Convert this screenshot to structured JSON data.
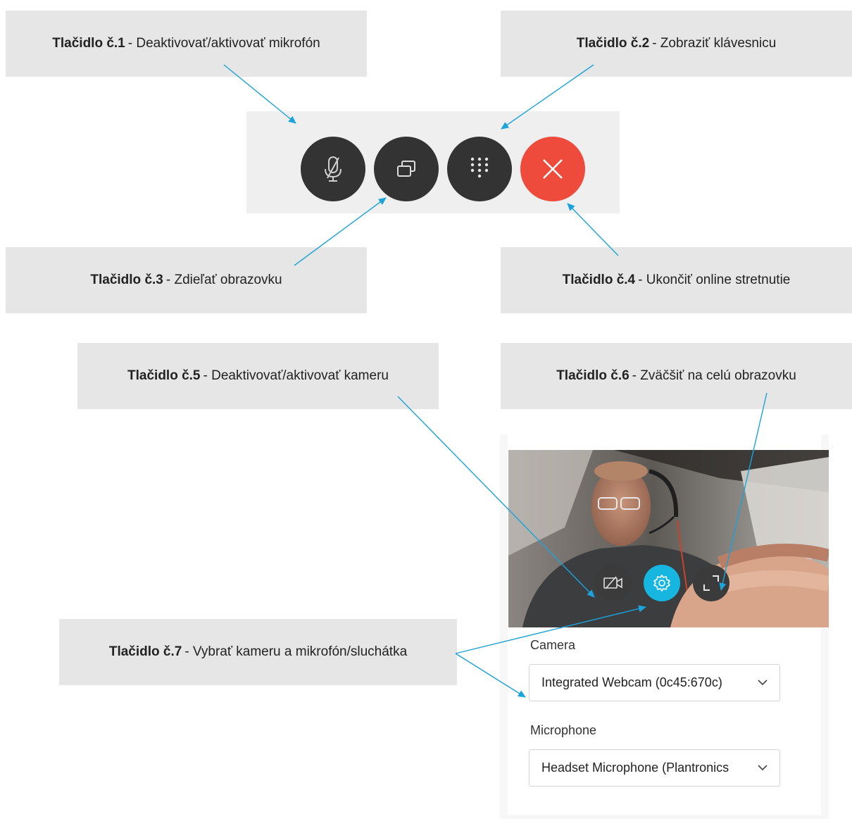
{
  "callouts": [
    {
      "bold": "Tlačidlo č.1",
      "text": " - Deaktivovať/aktivovať mikrofón"
    },
    {
      "bold": "Tlačidlo č.2",
      "text": " - Zobraziť klávesnicu"
    },
    {
      "bold": "Tlačidlo č.3",
      "text": " - Zdieľať obrazovku"
    },
    {
      "bold": "Tlačidlo č.4",
      "text": " - Ukončiť online stretnutie"
    },
    {
      "bold": "Tlačidlo č.5",
      "text": " - Deaktivovať/aktivovať kameru"
    },
    {
      "bold": "Tlačidlo č.6",
      "text": " - Zväčšiť na celú obrazovku"
    },
    {
      "bold": "Tlačidlo č.7",
      "text": " - Vybrať kameru a mikrofón/sluchátka"
    }
  ],
  "toolbar": {
    "buttons": [
      {
        "name": "mute-microphone",
        "icon": "microphone-off-icon"
      },
      {
        "name": "share-screen",
        "icon": "share-screen-icon"
      },
      {
        "name": "show-keypad",
        "icon": "keypad-icon"
      },
      {
        "name": "end-meeting",
        "icon": "close-icon"
      }
    ],
    "end_color": "#ef4b3c"
  },
  "device_panel": {
    "video_controls": [
      {
        "name": "camera-off",
        "icon": "camera-off-icon"
      },
      {
        "name": "settings",
        "icon": "gear-icon"
      },
      {
        "name": "fullscreen",
        "icon": "expand-icon"
      }
    ],
    "camera_label": "Camera",
    "camera_value": "Integrated Webcam (0c45:670c)",
    "microphone_label": "Microphone",
    "microphone_value": "Headset Microphone (Plantronics",
    "accent": "#16b6e0"
  },
  "arrow_color": "#1ba3dc"
}
